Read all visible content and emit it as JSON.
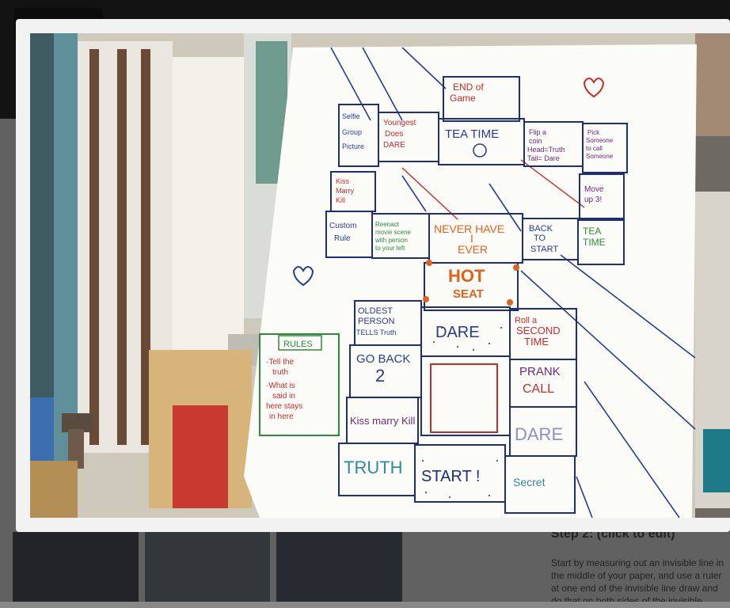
{
  "page": {
    "step_title": "Step 2: (click to edit)",
    "step_body": "Start by measuring out an invisible line in the middle of your paper, and use a ruler at one end of the invisible line draw and do that on both sides of the invisible"
  },
  "photo": {
    "rules_title": "RULES",
    "rules_lines": [
      "·Tell the",
      "truth",
      "·What is",
      "said in",
      "here stays",
      "in here"
    ],
    "cells": {
      "end_of_game": [
        "END of",
        "Game"
      ],
      "selfie": [
        "Selfie",
        "Group",
        "Picture"
      ],
      "youngest_does_dare": [
        "Youngest",
        "Does",
        "DARE"
      ],
      "tea_time_top": "TEA TIME",
      "flip_coin": [
        "Flip a",
        "coin",
        "Head=Truth",
        "Tail= Dare"
      ],
      "pick_someone": [
        "Pick",
        "Someone",
        "to call",
        "Someone"
      ],
      "kiss_marry_kill_1": [
        "Kiss",
        "Marry",
        "Kill"
      ],
      "move_up": [
        "Move",
        "up 3!"
      ],
      "custom_rule": [
        "Custom",
        "Rule"
      ],
      "reenact": [
        "Reenact",
        "movie scene",
        "with person",
        "to your left"
      ],
      "never_have_i_ever": [
        "NEVER HAVE",
        "I",
        "EVER"
      ],
      "back_to_start": [
        "BACK",
        "TO",
        "START"
      ],
      "tea_time_right": [
        "TEA",
        "TIME"
      ],
      "hot_seat": [
        "HOT",
        "SEAT"
      ],
      "oldest_person": [
        "OLDEST",
        "PERSON",
        "TELLS Truth"
      ],
      "dare_1": "DARE",
      "roll_second_time": [
        "Roll a",
        "SECOND",
        "TIME"
      ],
      "go_back_2": [
        "GO BACK",
        "2"
      ],
      "prank_call": [
        "PRANK",
        "CALL"
      ],
      "kiss_marry_kill_2": "Kiss marry Kill",
      "dare_2": "DARE",
      "truth": "TRUTH",
      "start": "START !",
      "secret": "Secret"
    }
  },
  "colors": {
    "lightbox_frame": "#f2f2f2",
    "overlay": "rgba(0,0,0,0.55)",
    "ink_blue": "#2b3a8f",
    "ink_orange": "#e0621c",
    "ink_red": "#c62a2a",
    "ink_purple": "#6a2a7a",
    "ink_green": "#2e8a3a"
  }
}
